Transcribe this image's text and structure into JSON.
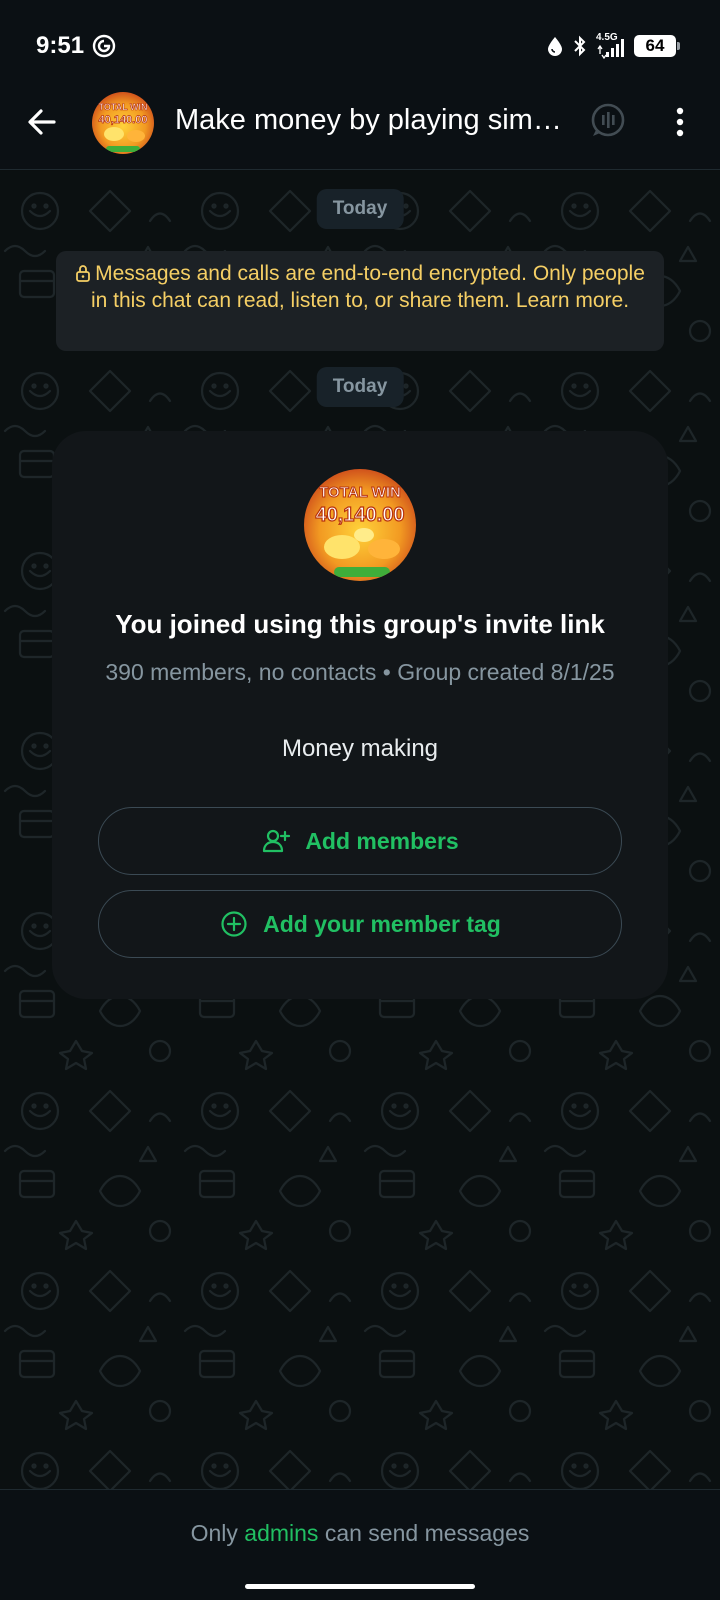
{
  "status_bar": {
    "time": "9:51",
    "network": "4.5G",
    "battery": "64",
    "icons": [
      "g-icon",
      "water-drop-icon",
      "bluetooth-icon",
      "signal-icon",
      "battery-icon"
    ]
  },
  "header": {
    "title": "Make money by playing sim…",
    "avatar_text_line1": "TOTAL WIN",
    "avatar_text_line2": "40,140.00",
    "icons": [
      "back-arrow-icon",
      "voice-chat-icon",
      "more-vert-icon"
    ]
  },
  "chat": {
    "date_chip_1": "Today",
    "encryption_notice": "Messages and calls are end-to-end encrypted. Only people in this chat can read, listen to, or share them. Learn more.",
    "date_chip_2": "Today",
    "card": {
      "avatar_text_line1": "TOTAL WIN",
      "avatar_text_line2": "40,140.00",
      "heading": "You joined using this group's invite link",
      "meta": "390 members, no contacts • Group created 8/1/25",
      "description": "Money making",
      "add_members_label": "Add members",
      "add_tag_label": "Add your member tag"
    }
  },
  "bottom": {
    "prefix": "Only",
    "admins": "admins",
    "suffix": "can send messages"
  },
  "colors": {
    "accent": "#21c063",
    "notice_text": "#f5cf65",
    "background": "#0b1011",
    "card": "#121619"
  }
}
